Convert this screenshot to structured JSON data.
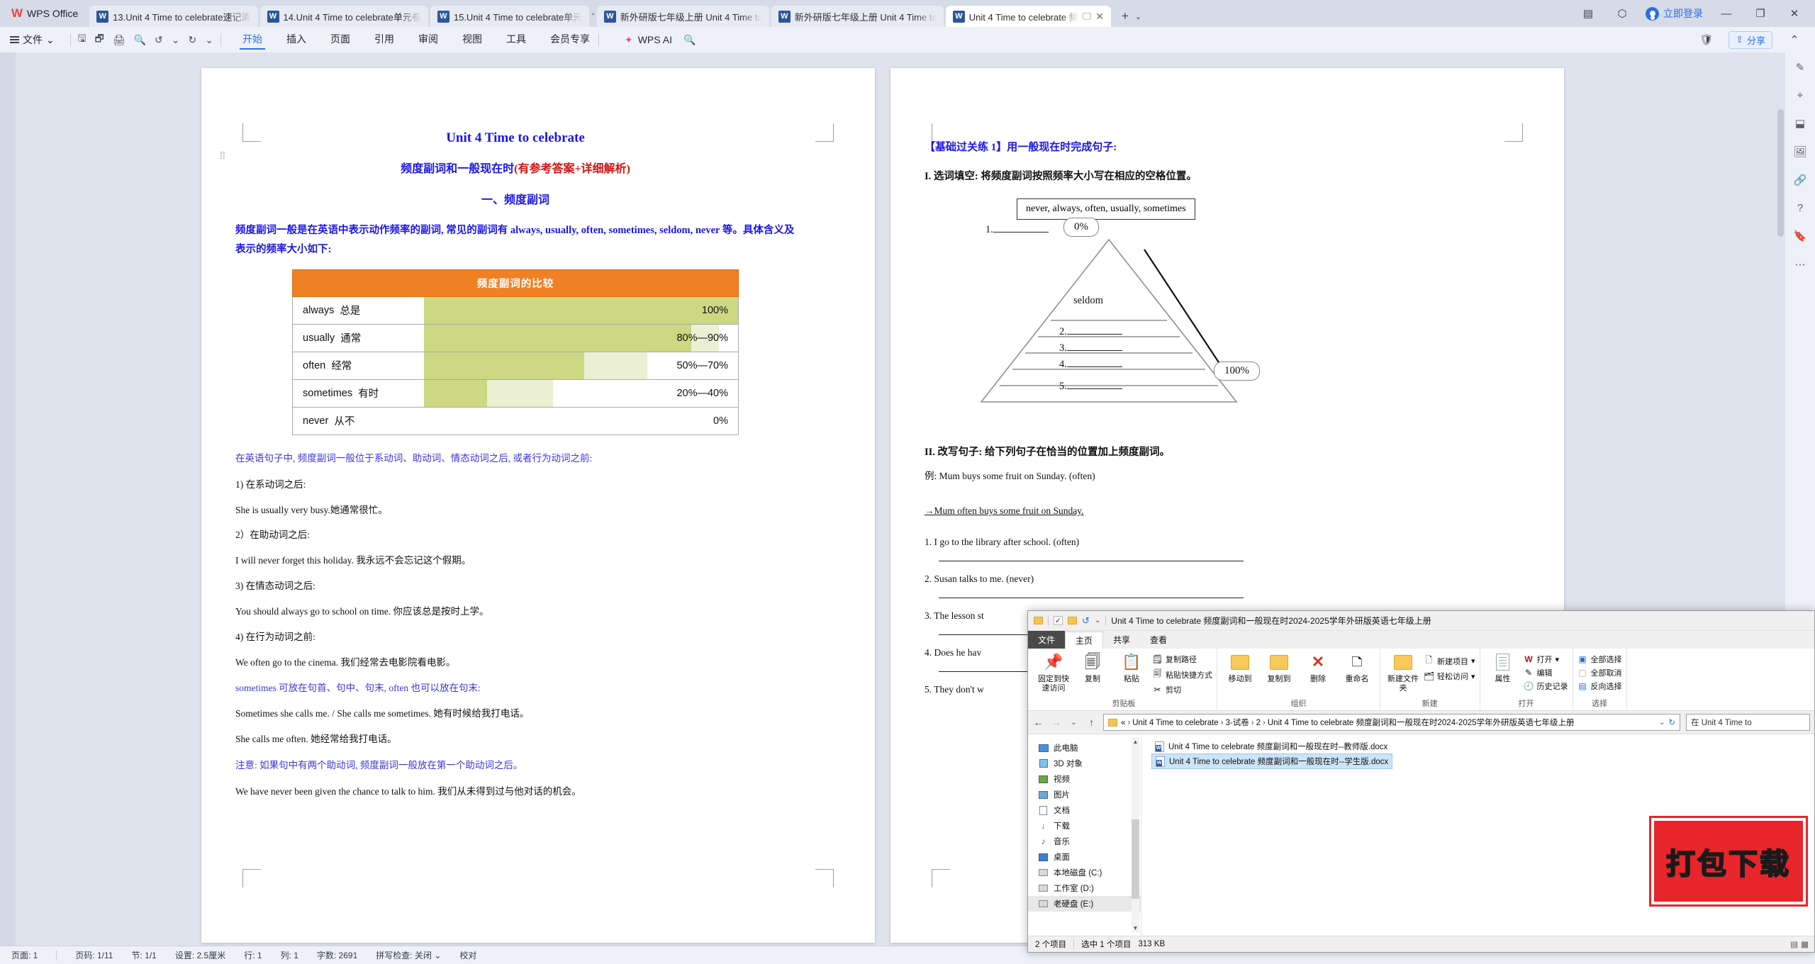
{
  "app": {
    "name": "WPS Office"
  },
  "tabbar": {
    "tabs": [
      {
        "label": "13.Unit 4 Time to celebrate速记清",
        "active": false
      },
      {
        "label": "14.Unit 4 Time to celebrate单元卷",
        "active": false
      },
      {
        "label": "15.Unit 4 Time to celebrate单元",
        "active": false
      },
      {
        "label": "新外研版七年级上册 Unit 4 Time to",
        "active": false
      },
      {
        "label": "新外研版七年级上册 Unit 4 Time to",
        "active": false
      },
      {
        "label": "Unit 4 Time to celebrate 频",
        "active": true
      }
    ],
    "add_label": "+",
    "chevron": "⌄",
    "login_label": "立即登录",
    "minimize": "—",
    "maximize": "❐",
    "close": "✕"
  },
  "ribbon": {
    "file_label": "文件",
    "file_chevron": "⌄",
    "quick_icons": [
      "save-icon",
      "save-as-icon",
      "print-icon",
      "print-preview-icon",
      "undo-icon",
      "undo-chevron",
      "redo-icon",
      "more-chevron"
    ],
    "tabs": [
      {
        "label": "开始",
        "selected": true
      },
      {
        "label": "插入",
        "selected": false
      },
      {
        "label": "页面",
        "selected": false
      },
      {
        "label": "引用",
        "selected": false
      },
      {
        "label": "审阅",
        "selected": false
      },
      {
        "label": "视图",
        "selected": false
      },
      {
        "label": "工具",
        "selected": false
      },
      {
        "label": "会员专享",
        "selected": false
      }
    ],
    "ai_label": "WPS AI",
    "search_icon": "🔍",
    "share_label": "分享",
    "collapse_icon": "⌃"
  },
  "document": {
    "title": "Unit 4 Time to celebrate",
    "subtitle_main": "频度副词和一般现在时",
    "subtitle_red": "(有参考答案+详细解析)",
    "section1": "一、频度副词",
    "intro": "频度副词一般是在英语中表示动作频率的副词, 常见的副词有 always, usually, often, sometimes, seldom, never 等。具体含义及表示的频率大小如下:",
    "table": {
      "header": "频度副词的比较",
      "rows": [
        {
          "word": "always",
          "cn": "总是",
          "value": "100%",
          "dark_start_pct": 0,
          "dark_end_pct": 100,
          "light_end_pct": 100
        },
        {
          "word": "usually",
          "cn": "通常",
          "value": "80%—90%",
          "dark_start_pct": 0,
          "dark_end_pct": 85,
          "light_end_pct": 94
        },
        {
          "word": "often",
          "cn": "经常",
          "value": "50%—70%",
          "dark_start_pct": 0,
          "dark_end_pct": 51,
          "light_end_pct": 71
        },
        {
          "word": "sometimes",
          "cn": "有时",
          "value": "20%—40%",
          "dark_start_pct": 0,
          "dark_end_pct": 20,
          "light_end_pct": 41
        },
        {
          "word": "never",
          "cn": "从不",
          "value": "0%",
          "dark_start_pct": 0,
          "dark_end_pct": 0,
          "light_end_pct": 0
        }
      ]
    },
    "rule_head": "在英语句子中, 频度副词一般位于系动词、助动词、情态动词之后, 或者行为动词之前:",
    "rules": [
      {
        "n": "1) 在系动词之后:",
        "example": "She is usually very busy.她通常很忙。"
      },
      {
        "n": "2）在助动词之后:",
        "example": "I will never forget this holiday.  我永远不会忘记这个假期。"
      },
      {
        "n": "3) 在情态动词之后:",
        "example": "You should always go to school on time.  你应该总是按时上学。"
      },
      {
        "n": "4) 在行为动词之前:",
        "example": "We often go to the cinema.  我们经常去电影院看电影。"
      }
    ],
    "note1_blue_a": "sometimes",
    "note1_mid": " 可放在句首、句中、句末,  ",
    "note1_blue_b": "often",
    "note1_end": " 也可以放在句末:",
    "note1_examples": [
      "Sometimes she calls me. / She calls me sometimes.  她有时候给我打电话。",
      "She calls me often.  她经常给我打电话。"
    ],
    "note2": "注意:  如果句中有两个助动词, 频度副词一般放在第一个助动词之后。",
    "note2_example": "We have never been given the chance to talk to him.  我们从未得到过与他对话的机会。"
  },
  "document_right": {
    "exercise_head": "【基础过关练 1】用一般现在时完成句子:",
    "q1_title": "I. 选词填空:  将频度副词按照频率大小写在相应的空格位置。",
    "wordbank": "never, always, often, usually, sometimes",
    "pyramid": {
      "top_label": "0%",
      "bottom_label": "100%",
      "levels": [
        {
          "num": "1.",
          "filled": ""
        },
        {
          "num": "",
          "filled": "seldom"
        },
        {
          "num": "2.",
          "filled": ""
        },
        {
          "num": "3.",
          "filled": ""
        },
        {
          "num": "4.",
          "filled": ""
        },
        {
          "num": "5.",
          "filled": ""
        }
      ]
    },
    "q2_title": "II. 改写句子:  给下列句子在恰当的位置加上频度副词。",
    "example_label": "例:  Mum buys some fruit on Sunday.  (often)",
    "example_answer": "→Mum often buys some fruit on Sunday.",
    "items": [
      "1. I go to the library after school.  (often)",
      "2. Susan talks to me.  (never)",
      "3. The lesson st",
      "4. Does he hav",
      "5. They don't w"
    ]
  },
  "statusbar": {
    "page_label": "页面: 1",
    "pages": "页码: 1/11",
    "section": "节: 1/1",
    "setting": "设置: 2.5厘米",
    "row": "行: 1",
    "col": "列: 1",
    "words": "字数: 2691",
    "spellcheck": "拼写检查: 关闭",
    "spell_chevron": "⌄",
    "proof": "校对"
  },
  "rightbar": {
    "icons": [
      "pencil-icon",
      "cursor-icon",
      "shapes-icon",
      "picture-icon",
      "link-icon",
      "help-icon",
      "bookmark-icon",
      "more-icon"
    ]
  },
  "explorer": {
    "title": "Unit 4 Time to celebrate 频度副词和一般现在时2024-2025学年外研版英语七年级上册",
    "qat": [
      "folder-icon",
      "properties-icon",
      "new-folder-icon",
      "undo-icon",
      "qat-chevron"
    ],
    "menu": [
      {
        "label": "文件",
        "kind": "file"
      },
      {
        "label": "主页",
        "kind": "active"
      },
      {
        "label": "共享",
        "kind": "normal"
      },
      {
        "label": "查看",
        "kind": "normal"
      }
    ],
    "groups": [
      {
        "name": "剪贴板",
        "big": [
          {
            "label": "固定到快速访问",
            "icon": "pin-icon"
          },
          {
            "label": "复制",
            "icon": "copy-icon"
          },
          {
            "label": "粘贴",
            "icon": "paste-icon"
          }
        ],
        "small": [
          {
            "label": "复制路径",
            "icon": "copy-path-icon"
          },
          {
            "label": "粘贴快捷方式",
            "icon": "paste-shortcut-icon"
          },
          {
            "label": "剪切",
            "icon": "scissors-icon"
          }
        ]
      },
      {
        "name": "组织",
        "big": [
          {
            "label": "移动到",
            "icon": "move-to-icon"
          },
          {
            "label": "复制到",
            "icon": "copy-to-icon"
          },
          {
            "label": "删除",
            "icon": "delete-icon"
          },
          {
            "label": "重命名",
            "icon": "rename-icon"
          }
        ],
        "small": []
      },
      {
        "name": "新建",
        "big": [
          {
            "label": "新建文件夹",
            "icon": "new-folder-icon"
          }
        ],
        "small": [
          {
            "label": "新建项目",
            "icon": "new-item-icon"
          },
          {
            "label": "轻松访问",
            "icon": "easy-access-icon"
          }
        ]
      },
      {
        "name": "打开",
        "big": [
          {
            "label": "属性",
            "icon": "properties-icon"
          }
        ],
        "small": [
          {
            "label": "打开",
            "icon": "open-icon"
          },
          {
            "label": "编辑",
            "icon": "edit-icon"
          },
          {
            "label": "历史记录",
            "icon": "history-icon"
          }
        ]
      },
      {
        "name": "选择",
        "big": [],
        "small": [
          {
            "label": "全部选择",
            "icon": "select-all-icon"
          },
          {
            "label": "全部取消",
            "icon": "select-none-icon"
          },
          {
            "label": "反向选择",
            "icon": "invert-selection-icon"
          }
        ]
      }
    ],
    "address": {
      "back_icon": "←",
      "fwd_icon": "→",
      "recent_icon": "⌄",
      "up_icon": "↑",
      "crumbs": [
        "Unit 4 Time to celebrate",
        "3-试卷",
        "2",
        "Unit 4 Time to celebrate 频度副词和一般现在时2024-2025学年外研版英语七年级上册"
      ],
      "prefix": "«",
      "dropdown_icon": "⌄",
      "refresh_icon": "↻",
      "search_placeholder": "在 Unit 4 Time to"
    },
    "nav": [
      {
        "label": "此电脑",
        "icon": "computer-icon",
        "selected": false
      },
      {
        "label": "3D 对象",
        "icon": "3d-objects-icon",
        "selected": false
      },
      {
        "label": "视频",
        "icon": "videos-icon",
        "selected": false
      },
      {
        "label": "图片",
        "icon": "pictures-icon",
        "selected": false
      },
      {
        "label": "文档",
        "icon": "documents-icon",
        "selected": false
      },
      {
        "label": "下载",
        "icon": "downloads-icon",
        "selected": false
      },
      {
        "label": "音乐",
        "icon": "music-icon",
        "selected": false
      },
      {
        "label": "桌面",
        "icon": "desktop-icon",
        "selected": false
      },
      {
        "label": "本地磁盘 (C:)",
        "icon": "disk-icon",
        "selected": false
      },
      {
        "label": "工作室 (D:)",
        "icon": "disk-icon",
        "selected": false
      },
      {
        "label": "老硬盘 (E:)",
        "icon": "disk-icon",
        "selected": true
      }
    ],
    "files": [
      {
        "name": "Unit 4 Time to celebrate 频度副词和一般现在时--教师版.docx",
        "selected": false
      },
      {
        "name": "Unit 4 Time to celebrate 频度副词和一般现在时--学生版.docx",
        "selected": true
      }
    ],
    "stamp_text": "打包下载",
    "status": {
      "count": "2 个项目",
      "selected": "选中 1 个项目",
      "size": "313 KB"
    }
  }
}
